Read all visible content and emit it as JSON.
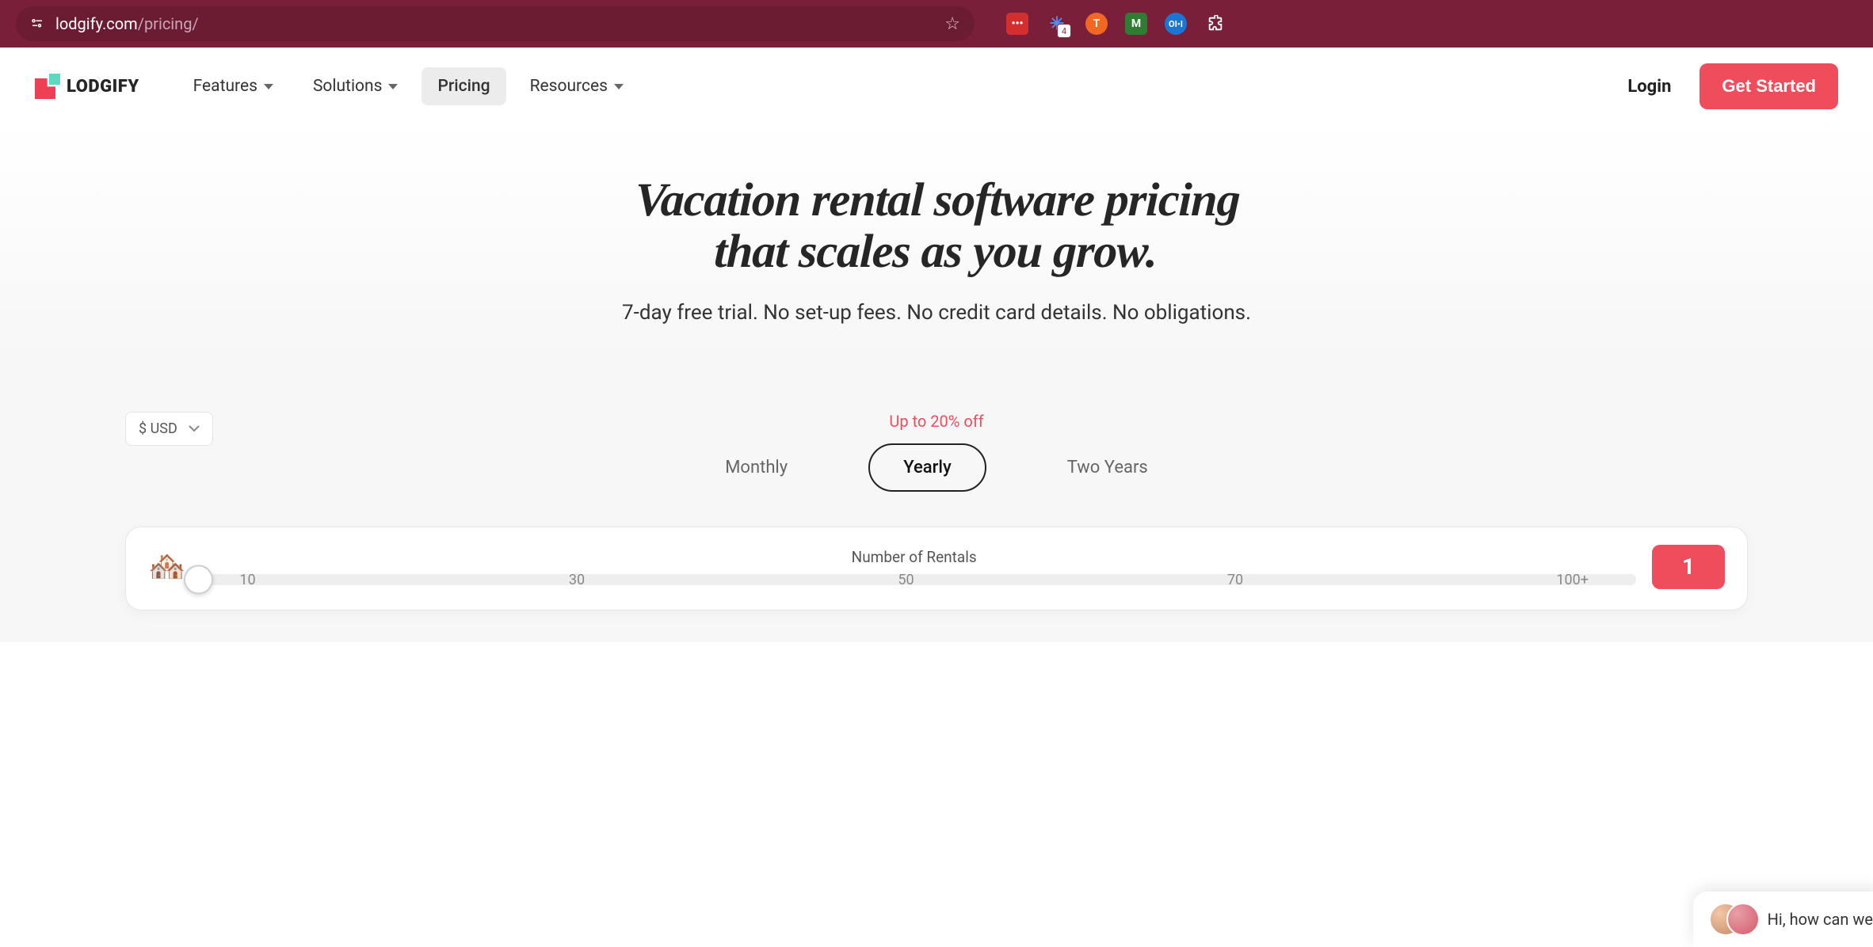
{
  "browser": {
    "url_domain": "lodgify.com",
    "url_path": "/pricing/",
    "extensions": {
      "lastpass": "•••",
      "loom_badge": "4",
      "torange": "T",
      "m_ext": "M",
      "otter": "OI•I"
    }
  },
  "header": {
    "logo_text": "LODGIFY",
    "nav": {
      "features": "Features",
      "solutions": "Solutions",
      "pricing": "Pricing",
      "resources": "Resources"
    },
    "login": "Login",
    "get_started": "Get Started"
  },
  "hero": {
    "title_line1": "Vacation rental software pricing",
    "title_line2": "that scales as you grow.",
    "subtitle": "7-day free trial. No set-up fees. No credit card details. No obligations."
  },
  "pricing": {
    "currency": "$ USD",
    "promo": "Up to 20% off",
    "billing": {
      "monthly": "Monthly",
      "yearly": "Yearly",
      "two_years": "Two Years"
    },
    "slider": {
      "label": "Number of Rentals",
      "ticks": [
        "10",
        "30",
        "50",
        "70",
        "100+"
      ],
      "value": "1"
    }
  },
  "chat": {
    "text": "Hi, how can we"
  }
}
